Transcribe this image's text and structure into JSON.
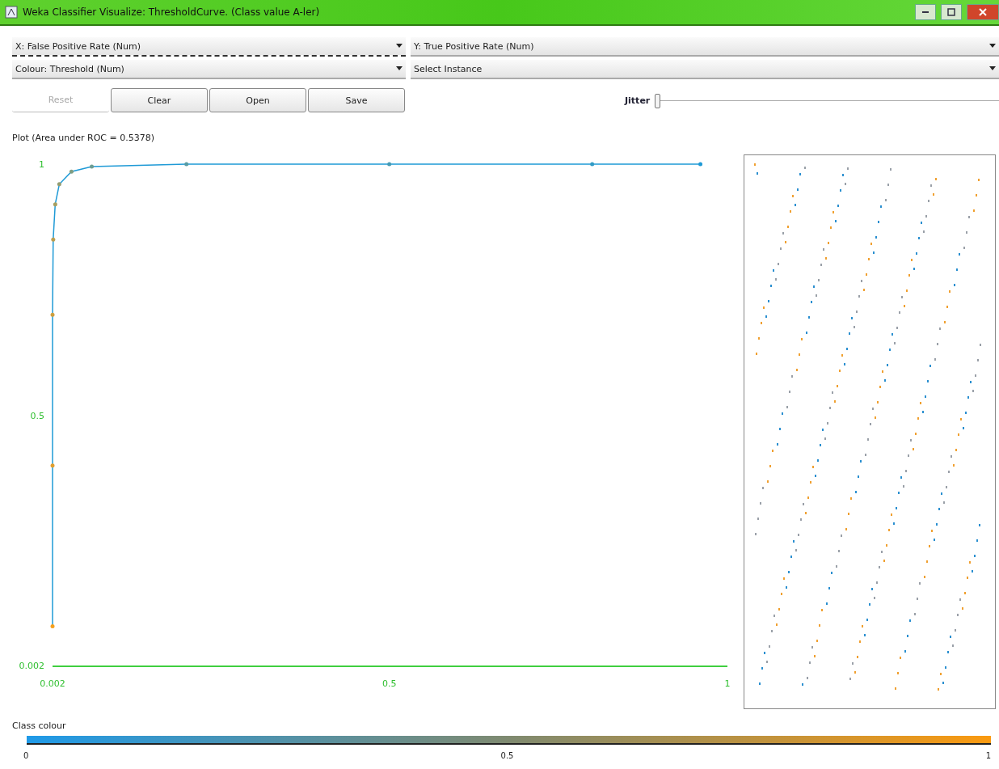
{
  "window": {
    "title": "Weka Classifier Visualize: ThresholdCurve. (Class value A-ler)"
  },
  "axis_selectors": [
    {
      "label": "X: False Positive Rate (Num)",
      "selected": true
    },
    {
      "label": "Y: True Positive Rate (Num)",
      "selected": false
    },
    {
      "label": "Colour: Threshold (Num)",
      "selected": false
    },
    {
      "label": "Select Instance",
      "selected": false
    }
  ],
  "buttons": [
    {
      "label": "Reset",
      "disabled": true
    },
    {
      "label": "Clear",
      "disabled": false
    },
    {
      "label": "Open",
      "disabled": false
    },
    {
      "label": "Save",
      "disabled": false
    }
  ],
  "jitter": {
    "label": "Jitter",
    "level": 0
  },
  "plot": {
    "title": "Plot (Area under ROC = 0.5378)",
    "chart_data": {
      "type": "line",
      "x": [
        0.002,
        0.002,
        0.002,
        0.003,
        0.006,
        0.012,
        0.03,
        0.06,
        0.2,
        0.5,
        0.8,
        0.96
      ],
      "series": [
        {
          "color": "#1f9ad6",
          "values": [
            0.08,
            0.4,
            0.7,
            0.85,
            0.92,
            0.96,
            0.985,
            0.995,
            1,
            1,
            1,
            1
          ]
        }
      ],
      "xlim": [
        0.002,
        1
      ],
      "ylim": [
        0.002,
        1
      ],
      "xticks": [
        {
          "value": 0.002,
          "label": "0.002"
        },
        {
          "value": 0.5,
          "label": "0.5"
        },
        {
          "value": 1,
          "label": "1"
        }
      ],
      "yticks": [
        {
          "value": 0.002,
          "label": "0.002"
        },
        {
          "value": 0.5,
          "label": "0.5"
        },
        {
          "value": 1,
          "label": "1"
        }
      ]
    }
  },
  "class_colour": {
    "title": "Class colour",
    "ticks": [
      "0",
      "0.5",
      "1"
    ]
  }
}
